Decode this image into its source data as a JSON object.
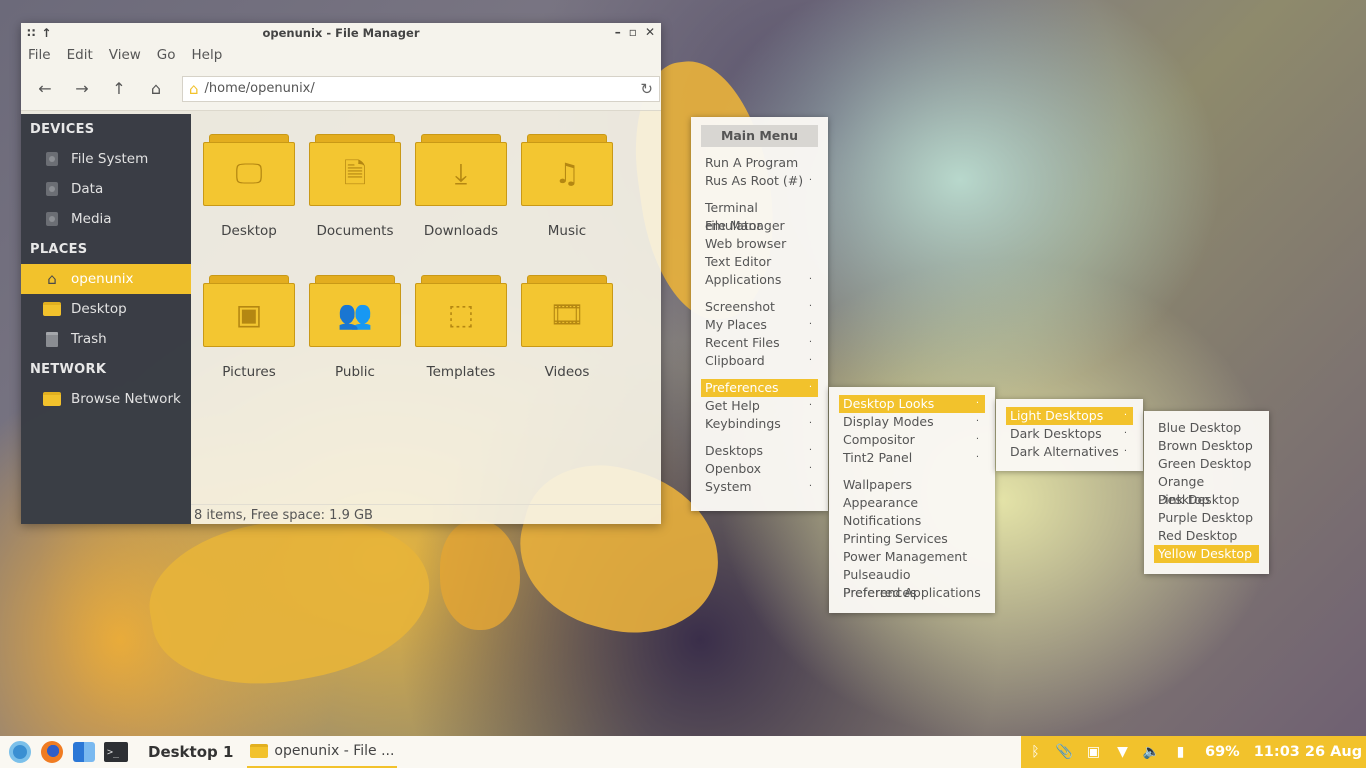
{
  "window": {
    "title": "openunix - File Manager",
    "menu": [
      "File",
      "Edit",
      "View",
      "Go",
      "Help"
    ],
    "address": "/home/openunix/",
    "status": "8 items, Free space: 1.9 GB"
  },
  "sidebar": {
    "devices_header": "DEVICES",
    "devices": [
      "File System",
      "Data",
      "Media"
    ],
    "places_header": "PLACES",
    "places": [
      "openunix",
      "Desktop",
      "Trash"
    ],
    "network_header": "NETWORK",
    "network": [
      "Browse Network"
    ]
  },
  "folders": [
    {
      "name": "Desktop",
      "icon": "monitor-icon"
    },
    {
      "name": "Documents",
      "icon": "document-icon"
    },
    {
      "name": "Downloads",
      "icon": "download-icon"
    },
    {
      "name": "Music",
      "icon": "music-note-icon"
    },
    {
      "name": "Pictures",
      "icon": "image-icon"
    },
    {
      "name": "Public",
      "icon": "users-icon"
    },
    {
      "name": "Templates",
      "icon": "dashed-square-icon"
    },
    {
      "name": "Videos",
      "icon": "film-icon"
    }
  ],
  "main_menu": {
    "title": "Main Menu",
    "groups": [
      [
        "Run A Program",
        "Rus As Root (#)"
      ],
      [
        "Terminal emulator",
        "File Manager",
        "Web browser",
        "Text Editor",
        "Applications"
      ],
      [
        "Screenshot",
        "My Places",
        "Recent Files",
        "Clipboard"
      ],
      [
        "Preferences",
        "Get Help",
        "Keybindings"
      ],
      [
        "Desktops",
        "Openbox",
        "System"
      ]
    ]
  },
  "prefs_menu": {
    "group1": [
      "Desktop Looks",
      "Display Modes",
      "Compositor",
      "Tint2 Panel"
    ],
    "group2": [
      "Wallpapers",
      "Appearance",
      "Notifications",
      "Printing Services",
      "Power Management",
      "Pulseaudio Preferences",
      "Preferred Applications"
    ]
  },
  "looks_menu": [
    "Light Desktops",
    "Dark Desktops",
    "Dark Alternatives"
  ],
  "light_menu": [
    "Blue Desktop",
    "Brown Desktop",
    "Green Desktop",
    "Orange Desktop",
    "Pink Desktop",
    "Purple Desktop",
    "Red Desktop",
    "Yellow Desktop"
  ],
  "taskbar": {
    "desktop": "Desktop 1",
    "task": "openunix - File ...",
    "battery": "69%",
    "clock": "11:03 26 Aug"
  },
  "colors": {
    "accent": "#f2c22c",
    "sidebar": "#32363e"
  }
}
